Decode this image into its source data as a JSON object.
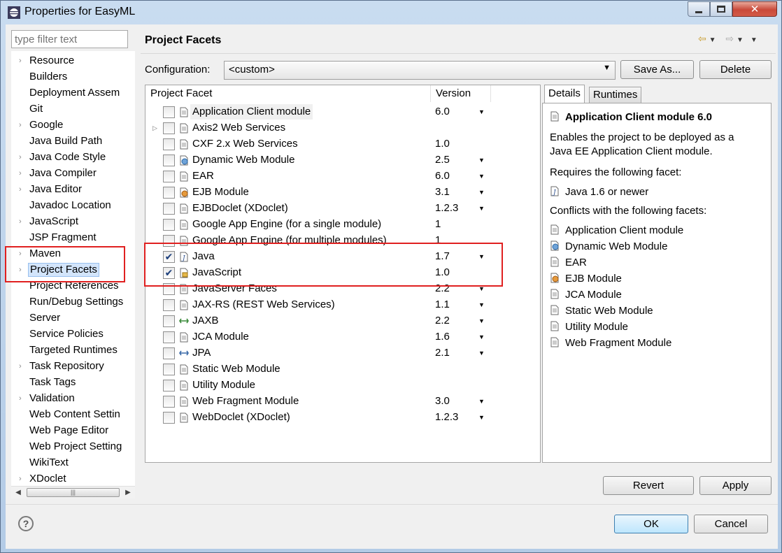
{
  "window": {
    "title": "Properties for EasyML"
  },
  "filter": {
    "placeholder": "type filter text"
  },
  "nav": {
    "items": [
      {
        "label": "Resource",
        "expandable": true
      },
      {
        "label": "Builders",
        "expandable": false
      },
      {
        "label": "Deployment Assem",
        "expandable": false
      },
      {
        "label": "Git",
        "expandable": false
      },
      {
        "label": "Google",
        "expandable": true
      },
      {
        "label": "Java Build Path",
        "expandable": false
      },
      {
        "label": "Java Code Style",
        "expandable": true
      },
      {
        "label": "Java Compiler",
        "expandable": true
      },
      {
        "label": "Java Editor",
        "expandable": true
      },
      {
        "label": "Javadoc Location",
        "expandable": false
      },
      {
        "label": "JavaScript",
        "expandable": true
      },
      {
        "label": "JSP Fragment",
        "expandable": false
      },
      {
        "label": "Maven",
        "expandable": true
      },
      {
        "label": "Project Facets",
        "expandable": true,
        "selected": true
      },
      {
        "label": "Project References",
        "expandable": false
      },
      {
        "label": "Run/Debug Settings",
        "expandable": false
      },
      {
        "label": "Server",
        "expandable": false
      },
      {
        "label": "Service Policies",
        "expandable": false
      },
      {
        "label": "Targeted Runtimes",
        "expandable": false
      },
      {
        "label": "Task Repository",
        "expandable": true
      },
      {
        "label": "Task Tags",
        "expandable": false
      },
      {
        "label": "Validation",
        "expandable": true
      },
      {
        "label": "Web Content Settin",
        "expandable": false
      },
      {
        "label": "Web Page Editor",
        "expandable": false
      },
      {
        "label": "Web Project Setting",
        "expandable": false
      },
      {
        "label": "WikiText",
        "expandable": false
      },
      {
        "label": "XDoclet",
        "expandable": true
      }
    ]
  },
  "page": {
    "title": "Project Facets"
  },
  "configuration": {
    "label": "Configuration:",
    "value": "<custom>",
    "save_as": "Save As...",
    "delete": "Delete"
  },
  "facets": {
    "col_facet": "Project Facet",
    "col_version": "Version",
    "rows": [
      {
        "name": "Application Client module",
        "version": "6.0",
        "checked": false,
        "dropdown": true,
        "icon": "module-icon"
      },
      {
        "name": "Axis2 Web Services",
        "version": "",
        "checked": false,
        "dropdown": false,
        "expandable": true,
        "icon": "module-icon"
      },
      {
        "name": "CXF 2.x Web Services",
        "version": "1.0",
        "checked": false,
        "dropdown": false,
        "icon": "module-icon"
      },
      {
        "name": "Dynamic Web Module",
        "version": "2.5",
        "checked": false,
        "dropdown": true,
        "icon": "web-module-icon"
      },
      {
        "name": "EAR",
        "version": "6.0",
        "checked": false,
        "dropdown": true,
        "icon": "module-icon"
      },
      {
        "name": "EJB Module",
        "version": "3.1",
        "checked": false,
        "dropdown": true,
        "icon": "ejb-icon"
      },
      {
        "name": "EJBDoclet (XDoclet)",
        "version": "1.2.3",
        "checked": false,
        "dropdown": true,
        "icon": "module-icon"
      },
      {
        "name": "Google App Engine (for a single module)",
        "version": "1",
        "checked": false,
        "dropdown": false,
        "icon": "module-icon"
      },
      {
        "name": "Google App Engine (for multiple modules)",
        "version": "1",
        "checked": false,
        "dropdown": false,
        "icon": "module-icon"
      },
      {
        "name": "Java",
        "version": "1.7",
        "checked": true,
        "dropdown": true,
        "icon": "java-icon"
      },
      {
        "name": "JavaScript",
        "version": "1.0",
        "checked": true,
        "dropdown": false,
        "icon": "javascript-icon"
      },
      {
        "name": "JavaServer Faces",
        "version": "2.2",
        "checked": false,
        "dropdown": true,
        "icon": "module-icon"
      },
      {
        "name": "JAX-RS (REST Web Services)",
        "version": "1.1",
        "checked": false,
        "dropdown": true,
        "icon": "module-icon"
      },
      {
        "name": "JAXB",
        "version": "2.2",
        "checked": false,
        "dropdown": true,
        "icon": "jaxb-icon"
      },
      {
        "name": "JCA Module",
        "version": "1.6",
        "checked": false,
        "dropdown": true,
        "icon": "module-icon"
      },
      {
        "name": "JPA",
        "version": "2.1",
        "checked": false,
        "dropdown": true,
        "icon": "jpa-icon"
      },
      {
        "name": "Static Web Module",
        "version": "",
        "checked": false,
        "dropdown": false,
        "icon": "module-icon"
      },
      {
        "name": "Utility Module",
        "version": "",
        "checked": false,
        "dropdown": false,
        "icon": "module-icon"
      },
      {
        "name": "Web Fragment Module",
        "version": "3.0",
        "checked": false,
        "dropdown": true,
        "icon": "module-icon"
      },
      {
        "name": "WebDoclet (XDoclet)",
        "version": "1.2.3",
        "checked": false,
        "dropdown": true,
        "icon": "module-icon"
      }
    ]
  },
  "details": {
    "tab_details": "Details",
    "tab_runtimes": "Runtimes",
    "title": "Application Client module 6.0",
    "description_line1": "Enables the project to be deployed as a",
    "description_line2": "Java EE Application Client module.",
    "requires_label": "Requires the following facet:",
    "requires": [
      "Java 1.6 or newer"
    ],
    "conflicts_label": "Conflicts with the following facets:",
    "conflicts": [
      "Application Client module",
      "Dynamic Web Module",
      "EAR",
      "EJB Module",
      "JCA Module",
      "Static Web Module",
      "Utility Module",
      "Web Fragment Module"
    ]
  },
  "buttons": {
    "revert": "Revert",
    "apply": "Apply",
    "ok": "OK",
    "cancel": "Cancel",
    "help": "?"
  },
  "colors": {
    "highlight_box": "#e02020",
    "selection": "#d3e5fb"
  }
}
